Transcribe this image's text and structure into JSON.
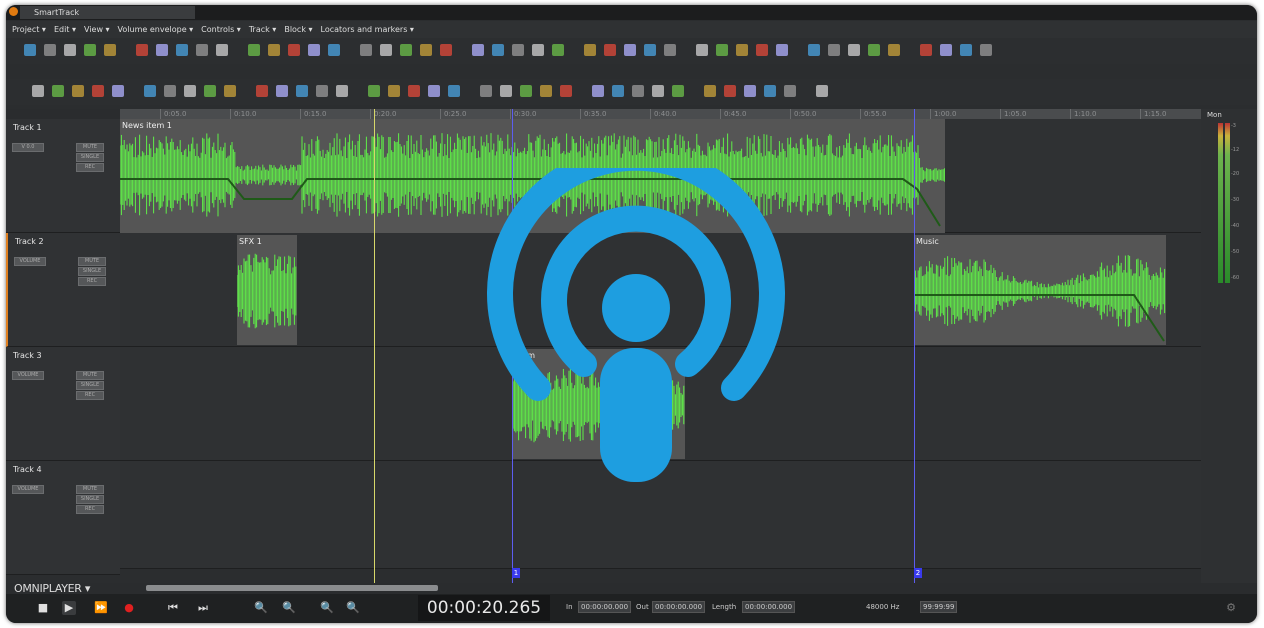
{
  "window": {
    "title": "SmartTrack"
  },
  "menu": [
    "Project ▾",
    "Edit ▾",
    "View ▾",
    "Volume envelope ▾",
    "Controls ▾",
    "Track ▾",
    "Block ▾",
    "Locators and markers ▾"
  ],
  "ruler": [
    "0:05.0",
    "0:10.0",
    "0:15.0",
    "0:20.0",
    "0:25.0",
    "0:30.0",
    "0:35.0",
    "0:40.0",
    "0:45.0",
    "0:50.0",
    "0:55.0",
    "1:00.0",
    "1:05.0",
    "1:10.0",
    "1:15.0"
  ],
  "tracks": [
    {
      "name": "Track 1",
      "mode": "V 0.0",
      "mute": "MUTE",
      "single": "SINGLE",
      "rec": "REC",
      "clips": [
        {
          "label": "News item 1"
        }
      ]
    },
    {
      "name": "Track 2",
      "mode": "VOLUME",
      "mute": "MUTE",
      "single": "SINGLE",
      "rec": "REC",
      "clips": [
        {
          "label": "SFX 1"
        },
        {
          "label": "Music"
        }
      ]
    },
    {
      "name": "Track 3",
      "mode": "VOLUME",
      "mute": "MUTE",
      "single": "SINGLE",
      "rec": "REC",
      "clips": [
        {
          "label": "Elem"
        }
      ]
    },
    {
      "name": "Track 4",
      "mode": "VOLUME",
      "mute": "MUTE",
      "single": "SINGLE",
      "rec": "REC",
      "clips": []
    }
  ],
  "markers": [
    "1",
    "2"
  ],
  "meter": {
    "label": "Mon",
    "scale": [
      "-3",
      "-12",
      "-20",
      "-30",
      "-40",
      "-50",
      "-60"
    ]
  },
  "omniplayer": {
    "label": "OMNIPLAYER ▾"
  },
  "transport": {
    "time": "00:00:20.265",
    "in_label": "In",
    "in_value": "00:00:00.000",
    "out_label": "Out",
    "out_value": "00:00:00.000",
    "length_label": "Length",
    "length_value": "00:00:00.000",
    "rate": "48000 Hz",
    "extra": "99:99:99"
  },
  "colors": {
    "wave": "#5fee48",
    "envelope": "#1f5a18",
    "overlay": "#1e9ee0",
    "marker": "#5d5df0",
    "cursor": "#d7d76a"
  }
}
